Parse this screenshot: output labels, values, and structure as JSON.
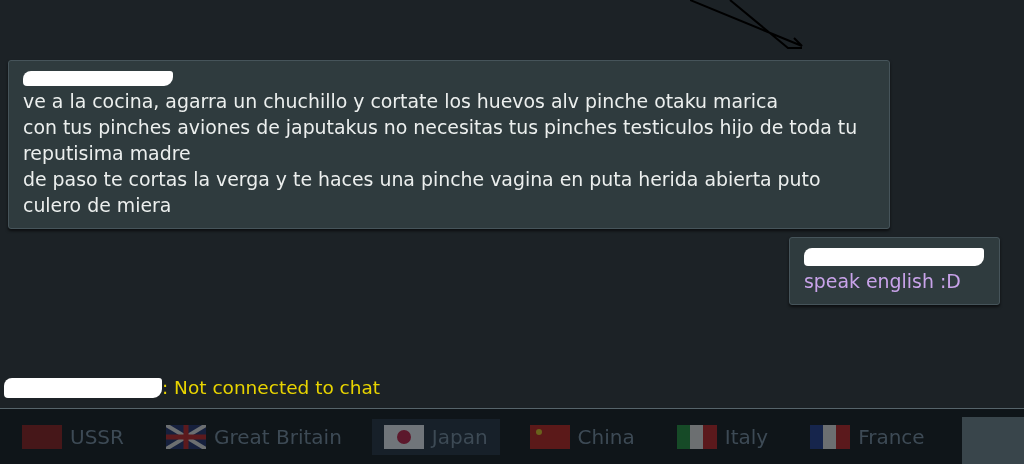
{
  "chat": {
    "messages": [
      {
        "kind": "left",
        "paragraphs": [
          "ve a la cocina, agarra un chuchillo y cortate los huevos alv pinche otaku marica",
          "con tus pinches aviones de japutakus no necesitas tus pinches testiculos hijo de toda tu reputisima madre",
          "de paso te cortas la verga y te haces una pinche vagina en puta herida abierta puto culero de miera"
        ]
      },
      {
        "kind": "right",
        "paragraphs": [
          "speak english :D"
        ]
      }
    ],
    "status": ": Not connected to chat"
  },
  "nation_tabs": [
    {
      "label": "USSR",
      "selected": false,
      "kind": "ussr"
    },
    {
      "label": "Great Britain",
      "selected": false,
      "kind": "uk"
    },
    {
      "label": "Japan",
      "selected": true,
      "kind": "japan"
    },
    {
      "label": "China",
      "selected": false,
      "kind": "china"
    },
    {
      "label": "Italy",
      "selected": false,
      "kind": "italy"
    },
    {
      "label": "France",
      "selected": false,
      "kind": "france"
    }
  ]
}
